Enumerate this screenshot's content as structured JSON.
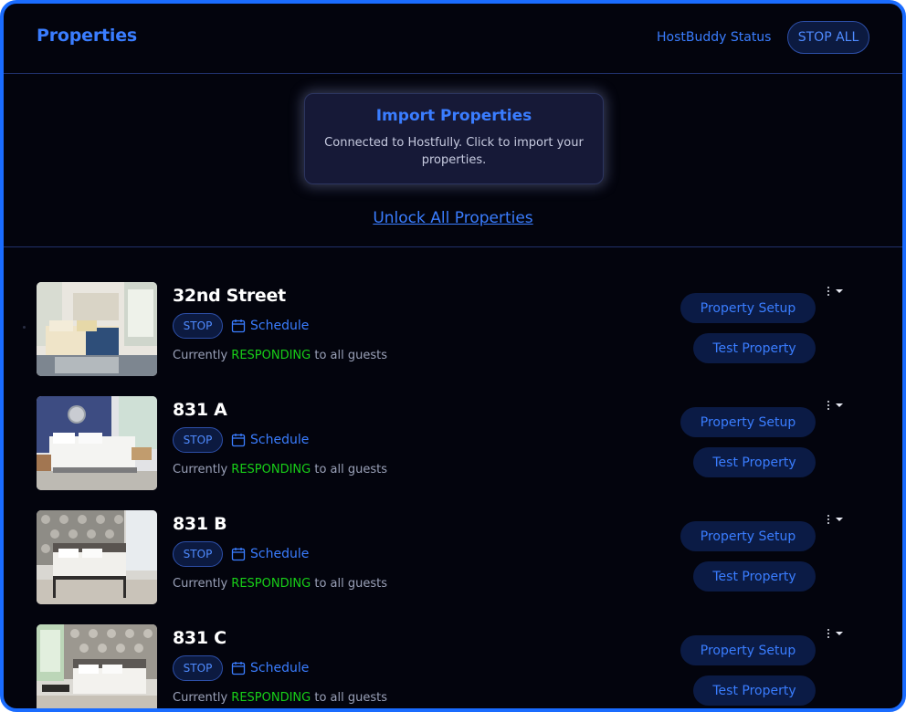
{
  "header": {
    "title": "Properties",
    "status_label": "HostBuddy Status",
    "stop_all_label": "STOP ALL"
  },
  "import": {
    "title": "Import Properties",
    "description": "Connected to Hostfully. Click to import your properties.",
    "unlock_link": "Unlock All Properties"
  },
  "properties": [
    {
      "name": "32nd Street",
      "stop_label": "STOP",
      "schedule_label": "Schedule",
      "status_prefix": "Currently",
      "status_value": "RESPONDING",
      "status_suffix": "to all guests",
      "setup_label": "Property Setup",
      "test_label": "Test Property"
    },
    {
      "name": "831 A",
      "stop_label": "STOP",
      "schedule_label": "Schedule",
      "status_prefix": "Currently",
      "status_value": "RESPONDING",
      "status_suffix": "to all guests",
      "setup_label": "Property Setup",
      "test_label": "Test Property"
    },
    {
      "name": "831 B",
      "stop_label": "STOP",
      "schedule_label": "Schedule",
      "status_prefix": "Currently",
      "status_value": "RESPONDING",
      "status_suffix": "to all guests",
      "setup_label": "Property Setup",
      "test_label": "Test Property"
    },
    {
      "name": "831 C",
      "stop_label": "STOP",
      "schedule_label": "Schedule",
      "status_prefix": "Currently",
      "status_value": "RESPONDING",
      "status_suffix": "to all guests",
      "setup_label": "Property Setup",
      "test_label": "Test Property"
    }
  ],
  "colors": {
    "accent": "#3a7dff",
    "background": "#03040d",
    "responding": "#18d018",
    "frame_border": "#1a6cff"
  },
  "icons": {
    "schedule": "calendar-icon",
    "row_menu": "kebab-menu-icon"
  }
}
